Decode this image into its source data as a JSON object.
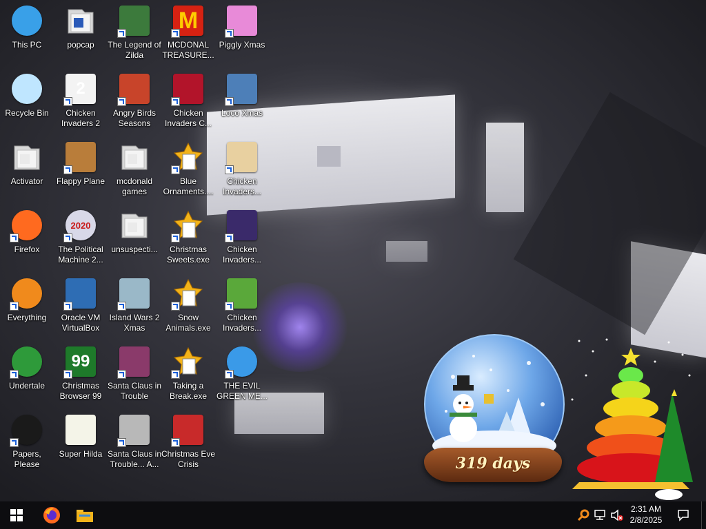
{
  "desktop": {
    "icons": [
      {
        "name": "this-pc",
        "label": "This PC",
        "col": 0,
        "row": 0,
        "icon": "computer-icon",
        "color": "#39a0e8",
        "glyph": "",
        "shortcut": false
      },
      {
        "name": "popcap",
        "label": "popcap",
        "col": 1,
        "row": 0,
        "icon": "folder-icon",
        "color": "#e8e8e8",
        "glyph": "",
        "shortcut": false
      },
      {
        "name": "legend-of-zilda",
        "label": "The Legend of Zilda",
        "col": 2,
        "row": 0,
        "icon": "zilda-game-icon",
        "color": "#3c7a3c",
        "glyph": "",
        "shortcut": true
      },
      {
        "name": "mcdonal-treasure",
        "label": "MCDONAL TREASURE...",
        "col": 3,
        "row": 0,
        "icon": "mcdonalds-logo-icon",
        "color": "#d62212",
        "glyph": "M",
        "shortcut": true
      },
      {
        "name": "piggly-xmas",
        "label": "Piggly Xmas",
        "col": 4,
        "row": 0,
        "icon": "pig-icon",
        "color": "#e88ad8",
        "glyph": "",
        "shortcut": true
      },
      {
        "name": "recycle-bin",
        "label": "Recycle Bin",
        "col": 0,
        "row": 1,
        "icon": "recycle-bin-icon",
        "color": "#bfe6ff",
        "glyph": "",
        "shortcut": false
      },
      {
        "name": "chicken-invaders-2",
        "label": "Chicken Invaders 2",
        "col": 1,
        "row": 1,
        "icon": "chicken-icon",
        "color": "#f3f3f3",
        "glyph": "2",
        "shortcut": true
      },
      {
        "name": "angry-birds-seasons",
        "label": "Angry Birds Seasons",
        "col": 2,
        "row": 1,
        "icon": "angry-bird-icon",
        "color": "#c8442a",
        "glyph": "",
        "shortcut": true
      },
      {
        "name": "chicken-invaders-c",
        "label": "Chicken Invaders C...",
        "col": 3,
        "row": 1,
        "icon": "chicken-snowman-icon",
        "color": "#b2142a",
        "glyph": "",
        "shortcut": true
      },
      {
        "name": "loco-xmas",
        "label": "Loco Xmas",
        "col": 4,
        "row": 1,
        "icon": "bear-icon",
        "color": "#4d7fb8",
        "glyph": "",
        "shortcut": true
      },
      {
        "name": "activator",
        "label": "Activator",
        "col": 0,
        "row": 2,
        "icon": "folder-icon",
        "color": "#e8e8e8",
        "glyph": "",
        "shortcut": false
      },
      {
        "name": "flappy-plane",
        "label": "Flappy Plane",
        "col": 1,
        "row": 2,
        "icon": "plane-icon",
        "color": "#b97d3a",
        "glyph": "",
        "shortcut": true
      },
      {
        "name": "mcdonald-games",
        "label": "mcdonald games",
        "col": 2,
        "row": 2,
        "icon": "folder-icon",
        "color": "#e8e8e8",
        "glyph": "",
        "shortcut": false
      },
      {
        "name": "blue-ornaments",
        "label": "Blue Ornaments....",
        "col": 3,
        "row": 2,
        "icon": "exe-file-icon",
        "color": "#f2b31a",
        "glyph": "",
        "shortcut": true
      },
      {
        "name": "chicken-invaders-a",
        "label": "Chicken Invaders...",
        "col": 4,
        "row": 2,
        "icon": "chicken-santa-icon",
        "color": "#e8d0a0",
        "glyph": "",
        "shortcut": true
      },
      {
        "name": "firefox",
        "label": "Firefox",
        "col": 0,
        "row": 3,
        "icon": "firefox-icon",
        "color": "#ff6a1f",
        "glyph": "",
        "shortcut": true
      },
      {
        "name": "political-machine",
        "label": "The Political Machine 2...",
        "col": 1,
        "row": 3,
        "icon": "political-machine-icon",
        "color": "#d8d8e8",
        "glyph": "2020",
        "shortcut": true
      },
      {
        "name": "unsuspecti",
        "label": "unsuspecti...",
        "col": 2,
        "row": 3,
        "icon": "folder-icon",
        "color": "#e8e8e8",
        "glyph": "",
        "shortcut": false
      },
      {
        "name": "christmas-sweets",
        "label": "Christmas Sweets.exe",
        "col": 3,
        "row": 3,
        "icon": "exe-file-icon",
        "color": "#f2b31a",
        "glyph": "",
        "shortcut": true
      },
      {
        "name": "chicken-invaders-b",
        "label": "Chicken Invaders...",
        "col": 4,
        "row": 3,
        "icon": "chicken-space-icon",
        "color": "#3a2a6a",
        "glyph": "",
        "shortcut": true
      },
      {
        "name": "everything",
        "label": "Everything",
        "col": 0,
        "row": 4,
        "icon": "magnifier-icon",
        "color": "#f08a1c",
        "glyph": "",
        "shortcut": true
      },
      {
        "name": "oracle-vm",
        "label": "Oracle VM VirtualBox",
        "col": 1,
        "row": 4,
        "icon": "virtualbox-icon",
        "color": "#2e6db4",
        "glyph": "",
        "shortcut": true
      },
      {
        "name": "island-wars-2",
        "label": "Island Wars 2 Xmas",
        "col": 2,
        "row": 4,
        "icon": "island-icon",
        "color": "#9ab8c8",
        "glyph": "",
        "shortcut": true
      },
      {
        "name": "snow-animals",
        "label": "Snow Animals.exe",
        "col": 3,
        "row": 4,
        "icon": "exe-file-icon",
        "color": "#f2b31a",
        "glyph": "",
        "shortcut": true
      },
      {
        "name": "chicken-invaders-d",
        "label": "Chicken Invaders...",
        "col": 4,
        "row": 4,
        "icon": "chicken-green-icon",
        "color": "#5aa83a",
        "glyph": "",
        "shortcut": true
      },
      {
        "name": "undertale",
        "label": "Undertale",
        "col": 0,
        "row": 5,
        "icon": "undertale-icon",
        "color": "#2e9a3a",
        "glyph": "",
        "shortcut": true
      },
      {
        "name": "christmas-browser-99",
        "label": "Christmas Browser 99",
        "col": 1,
        "row": 5,
        "icon": "xmas-tree-icon",
        "color": "#1e7a2a",
        "glyph": "99",
        "shortcut": true
      },
      {
        "name": "santa-claus-trouble",
        "label": "Santa Claus in Trouble",
        "col": 2,
        "row": 5,
        "icon": "santa-icon",
        "color": "#8a3a6a",
        "glyph": "",
        "shortcut": true
      },
      {
        "name": "taking-a-break",
        "label": "Taking a Break.exe",
        "col": 3,
        "row": 5,
        "icon": "exe-file-icon",
        "color": "#f2b31a",
        "glyph": "",
        "shortcut": true
      },
      {
        "name": "evil-green-me",
        "label": "THE EVIL GREEN ME...",
        "col": 4,
        "row": 5,
        "icon": "messenger-icon",
        "color": "#3a9ae8",
        "glyph": "",
        "shortcut": true
      },
      {
        "name": "papers-please",
        "label": "Papers, Please",
        "col": 0,
        "row": 6,
        "icon": "papers-please-icon",
        "color": "#1a1a1a",
        "glyph": "",
        "shortcut": true
      },
      {
        "name": "super-hilda",
        "label": "Super Hilda",
        "col": 1,
        "row": 6,
        "icon": "pixel-cat-icon",
        "color": "#f4f4e8",
        "glyph": "",
        "shortcut": false
      },
      {
        "name": "santa-claus-trouble-a",
        "label": "Santa Claus in Trouble... A...",
        "col": 2,
        "row": 6,
        "icon": "santa-icon",
        "color": "#b8b8b8",
        "glyph": "",
        "shortcut": true
      },
      {
        "name": "christmas-eve-crisis",
        "label": "Christmas Eve Crisis",
        "col": 3,
        "row": 6,
        "icon": "santa-icon",
        "color": "#c82a2a",
        "glyph": "",
        "shortcut": true
      }
    ]
  },
  "widgets": {
    "snow_globe_days": "319 days"
  },
  "taskbar": {
    "clock_time": "2:31 AM",
    "clock_date": "2/8/2025"
  }
}
